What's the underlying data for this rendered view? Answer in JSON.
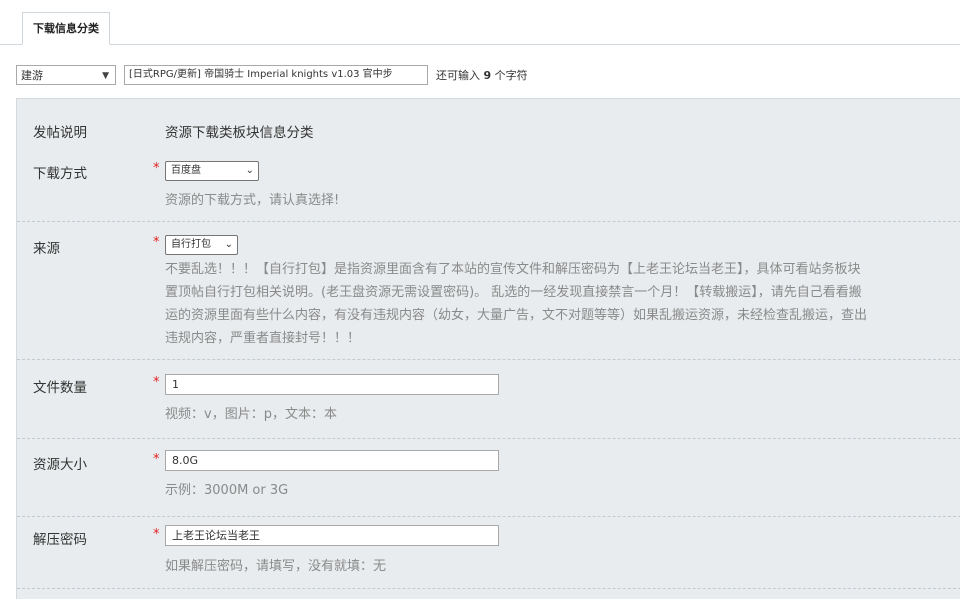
{
  "tab": {
    "label": "下载信息分类"
  },
  "subject": {
    "type_value": "建游",
    "title_value": "[日式RPG/更新] 帝国骑士 Imperial knights v1.03 官中步",
    "hint_prefix": "还可输入",
    "hint_count": "9",
    "hint_suffix": "个字符"
  },
  "form": {
    "intro": {
      "label": "发帖说明",
      "value": "资源下载类板块信息分类"
    },
    "download_method": {
      "label": "下载方式",
      "required": "*",
      "value": "百度盘",
      "hint": "资源的下载方式，请认真选择!"
    },
    "source": {
      "label": "来源",
      "required": "*",
      "value": "自行打包",
      "note_lines": [
        "不要乱选！！！【自行打包】是指资源里面含有了本站的宣传文件和解压密码为【上老王论坛当老王】，具体可看站务板块",
        "置顶帖自行打包相关说明。(老王盘资源无需设置密码)。 乱选的一经发现直接禁言一个月！【转载搬运】，请先自己看看搬",
        "运的资源里面有些什么内容，有没有违规内容（幼女，大量广告，文不对题等等）如果乱搬运资源，未经检查乱搬运，查出",
        "违规内容，严重者直接封号！！！"
      ]
    },
    "file_count": {
      "label": "文件数量",
      "required": "*",
      "value": "1",
      "hint": "视频：v，图片：p，文本：本"
    },
    "size": {
      "label": "资源大小",
      "required": "*",
      "value": "8.0G",
      "hint": "示例：3000M or 3G"
    },
    "password": {
      "label": "解压密码",
      "required": "*",
      "value": "上老王论坛当老王",
      "hint": "如果解压密码，请填写，没有就填：无"
    }
  },
  "icons": {
    "dropdown": "chevron-down-icon"
  }
}
